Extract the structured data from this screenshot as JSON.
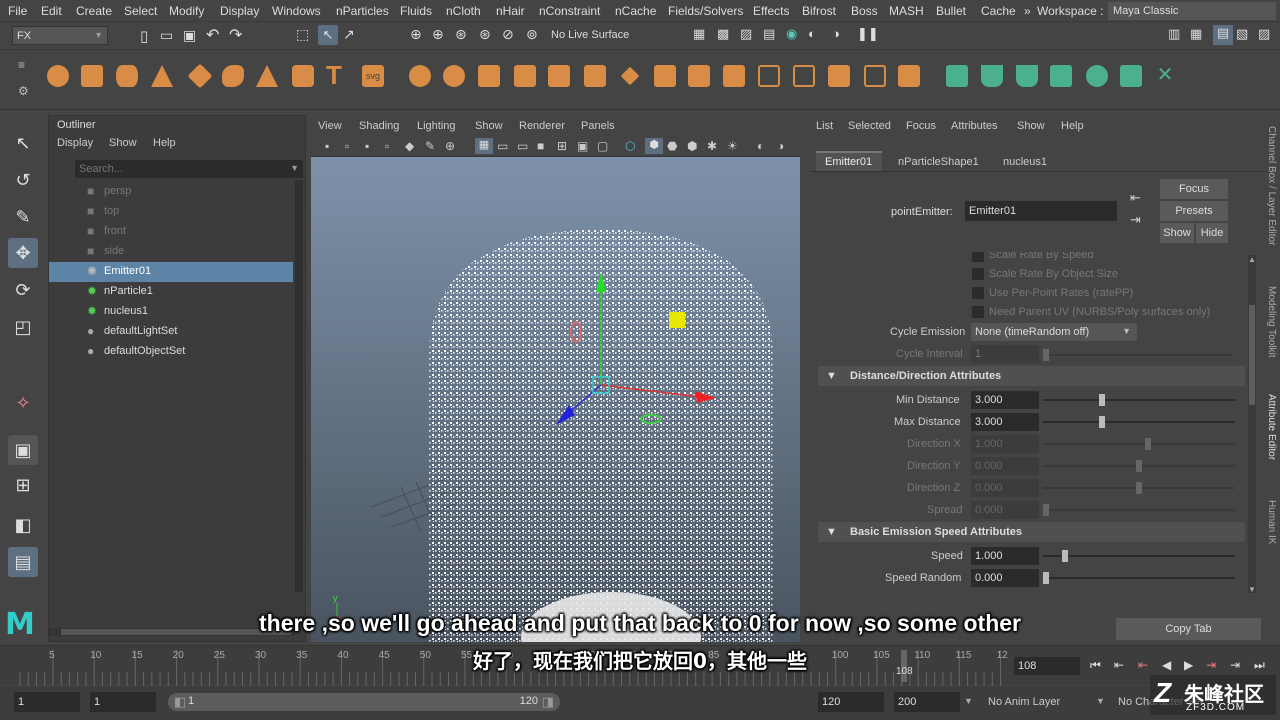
{
  "menubar": {
    "items": [
      "File",
      "Edit",
      "Create",
      "Select",
      "Modify",
      "Display",
      "Windows",
      "nParticles",
      "Fluids",
      "nCloth",
      "nHair",
      "nConstraint",
      "nCache",
      "Fields/Solvers",
      "Effects",
      "Bifrost",
      "Boss",
      "MASH",
      "Bullet",
      "Cache"
    ],
    "more": "»",
    "workspace_label": "Workspace :",
    "workspace_value": "Maya Classic"
  },
  "statusline": {
    "menuset": "FX",
    "live_surface": "No Live Surface"
  },
  "outliner": {
    "title": "Outliner",
    "menu": [
      "Display",
      "Show",
      "Help"
    ],
    "search_placeholder": "Search...",
    "items": [
      {
        "label": "persp",
        "icon": "camera-icon",
        "dim": true,
        "selected": false
      },
      {
        "label": "top",
        "icon": "camera-icon",
        "dim": true,
        "selected": false
      },
      {
        "label": "front",
        "icon": "camera-icon",
        "dim": true,
        "selected": false
      },
      {
        "label": "side",
        "icon": "camera-icon",
        "dim": true,
        "selected": false
      },
      {
        "label": "Emitter01",
        "icon": "emitter-icon",
        "dim": false,
        "selected": true
      },
      {
        "label": "nParticle1",
        "icon": "nparticle-icon",
        "dim": false,
        "selected": false
      },
      {
        "label": "nucleus1",
        "icon": "nucleus-icon",
        "dim": false,
        "selected": false
      },
      {
        "label": "defaultLightSet",
        "icon": "set-icon",
        "dim": false,
        "selected": false
      },
      {
        "label": "defaultObjectSet",
        "icon": "set-icon",
        "dim": false,
        "selected": false
      }
    ]
  },
  "viewport": {
    "menu": [
      "View",
      "Shading",
      "Lighting",
      "Show",
      "Renderer",
      "Panels"
    ],
    "axis_y": "y"
  },
  "attribute_editor": {
    "menu": [
      "List",
      "Selected",
      "Focus",
      "Attributes",
      "Show",
      "Help"
    ],
    "tabs": [
      "Emitter01",
      "nParticleShape1",
      "nucleus1"
    ],
    "node_label": "pointEmitter:",
    "node_value": "Emitter01",
    "focus": "Focus",
    "presets": "Presets",
    "show": "Show",
    "hide": "Hide",
    "checkboxes": [
      "Scale Rate By Speed",
      "Scale Rate By Object Size",
      "Use Per-Point Rates (ratePP)",
      "Need Parent UV (NURBS/Poly surfaces only)"
    ],
    "cycle_emission_label": "Cycle Emission",
    "cycle_emission_value": "None (timeRandom off)",
    "cycle_interval_label": "Cycle Interval",
    "cycle_interval_value": "1",
    "section_distance": "Distance/Direction Attributes",
    "min_distance_label": "Min Distance",
    "min_distance": "3.000",
    "max_distance_label": "Max Distance",
    "max_distance": "3.000",
    "direction_x_label": "Direction X",
    "direction_x": "1.000",
    "direction_y_label": "Direction Y",
    "direction_y": "0.000",
    "direction_z_label": "Direction Z",
    "direction_z": "0.000",
    "spread_label": "Spread",
    "spread": "0.000",
    "section_speed": "Basic Emission Speed Attributes",
    "speed_label": "Speed",
    "speed": "1.000",
    "speed_random_label": "Speed Random",
    "speed_random": "0.000",
    "copy_tab": "Copy Tab"
  },
  "side_tabs": [
    "Channel Box / Layer Editor",
    "Modeling Toolkit",
    "Attribute Editor",
    "Human IK"
  ],
  "timeslider": {
    "ticks": [
      "5",
      "10",
      "15",
      "20",
      "25",
      "30",
      "35",
      "40",
      "45",
      "50",
      "55",
      "60",
      "65",
      "70",
      "75",
      "80",
      "85",
      "90",
      "95",
      "100",
      "105",
      "110",
      "115",
      "12"
    ],
    "current_frame_marker": "108",
    "current_frame": "108"
  },
  "rangeslider": {
    "start": "1",
    "start_inner": "1",
    "range_start_label": "1",
    "range_end_label": "120",
    "end": "120",
    "end_outer": "200",
    "anim_layer": "No Anim Layer",
    "char_set": "No Character Set"
  },
  "subtitles": {
    "english": "there ,so we'll go ahead and put that back to 0 for now ,so some other",
    "chinese": "好了，现在我们把它放回0，其他一些"
  },
  "watermark": {
    "cn": "朱峰社区",
    "url": "ZF3D.COM"
  }
}
